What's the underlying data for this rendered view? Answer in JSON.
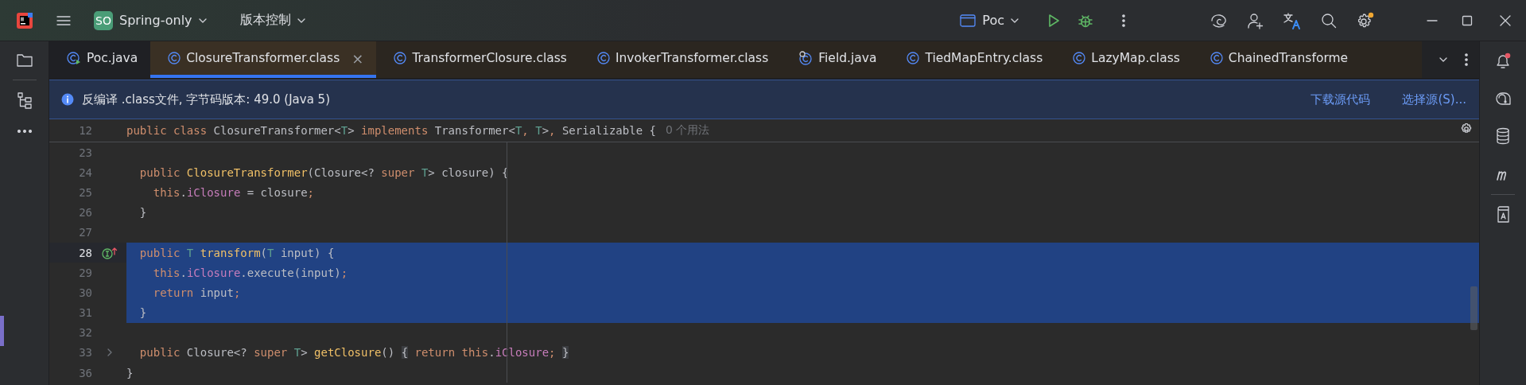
{
  "title_bar": {
    "project_badge": "SO",
    "project": "Spring-only",
    "vcs": "版本控制",
    "run_config": "Poc"
  },
  "tabs": [
    {
      "label": "Poc.java",
      "kind": "runnable",
      "selected": false
    },
    {
      "label": "ClosureTransformer.class",
      "kind": "class",
      "selected": true,
      "close": "×"
    },
    {
      "label": "TransformerClosure.class",
      "kind": "class",
      "selected": false
    },
    {
      "label": "InvokerTransformer.class",
      "kind": "class",
      "selected": false
    },
    {
      "label": "Field.java",
      "kind": "locked",
      "selected": false
    },
    {
      "label": "TiedMapEntry.class",
      "kind": "class",
      "selected": false
    },
    {
      "label": "LazyMap.class",
      "kind": "class",
      "selected": false
    },
    {
      "label": "ChainedTransforme",
      "kind": "class",
      "selected": false
    }
  ],
  "banner": {
    "text": "反编译 .class文件, 字节码版本: 49.0 (Java 5)",
    "links": [
      "下载源代码",
      "选择源(S)..."
    ]
  },
  "editor": {
    "sticky": {
      "number": "12",
      "hint": "0 个用法",
      "tokens": [
        {
          "text": "public class ",
          "kind": "kw"
        },
        {
          "text": "ClosureTransformer<",
          "kind": "plain"
        },
        {
          "text": "T",
          "kind": "tparam"
        },
        {
          "text": "> ",
          "kind": "plain"
        },
        {
          "text": "implements ",
          "kind": "kw"
        },
        {
          "text": "Transformer<",
          "kind": "plain"
        },
        {
          "text": "T",
          "kind": "tparam"
        },
        {
          "text": ", ",
          "kind": "kw"
        },
        {
          "text": "T",
          "kind": "tparam"
        },
        {
          "text": ">",
          "kind": "plain"
        },
        {
          "text": ", ",
          "kind": "kw"
        },
        {
          "text": "Serializable {",
          "kind": "plain"
        }
      ]
    },
    "lines": [
      {
        "number": "23",
        "selected": false,
        "current": false
      },
      {
        "number": "24",
        "selected": false,
        "current": false,
        "tokens": [
          {
            "text": "  public ",
            "kind": "kw"
          },
          {
            "text": "ClosureTransformer",
            "kind": "decl"
          },
          {
            "text": "(Closure<? ",
            "kind": "plain"
          },
          {
            "text": "super ",
            "kind": "kw"
          },
          {
            "text": "T",
            "kind": "tparam"
          },
          {
            "text": "> closure) {",
            "kind": "plain"
          }
        ]
      },
      {
        "number": "25",
        "selected": false,
        "current": false,
        "tokens": [
          {
            "text": "    this",
            "kind": "kw"
          },
          {
            "text": ".",
            "kind": "plain"
          },
          {
            "text": "iClosure",
            "kind": "field"
          },
          {
            "text": " = closure",
            "kind": "plain"
          },
          {
            "text": ";",
            "kind": "kw"
          }
        ]
      },
      {
        "number": "26",
        "selected": false,
        "current": false,
        "tokens": [
          {
            "text": "  }",
            "kind": "plain"
          }
        ]
      },
      {
        "number": "27",
        "selected": false,
        "current": false
      },
      {
        "number": "28",
        "selected": true,
        "current": true,
        "implementation_marker": true,
        "tokens": [
          {
            "text": "  public ",
            "kind": "kw"
          },
          {
            "text": "T ",
            "kind": "tparam"
          },
          {
            "text": "transform",
            "kind": "decl"
          },
          {
            "text": "(",
            "kind": "plain"
          },
          {
            "text": "T ",
            "kind": "tparam"
          },
          {
            "text": "input) {",
            "kind": "plain"
          }
        ]
      },
      {
        "number": "29",
        "selected": true,
        "current": false,
        "tokens": [
          {
            "text": "    this",
            "kind": "kw"
          },
          {
            "text": ".",
            "kind": "plain"
          },
          {
            "text": "iClosure",
            "kind": "field"
          },
          {
            "text": ".execute(input)",
            "kind": "plain"
          },
          {
            "text": ";",
            "kind": "kw"
          }
        ]
      },
      {
        "number": "30",
        "selected": true,
        "current": false,
        "tokens": [
          {
            "text": "    return ",
            "kind": "kw"
          },
          {
            "text": "input",
            "kind": "plain"
          },
          {
            "text": ";",
            "kind": "kw"
          }
        ]
      },
      {
        "number": "31",
        "selected": true,
        "current": false,
        "tokens": [
          {
            "text": "  }",
            "kind": "plain"
          }
        ]
      },
      {
        "number": "32",
        "selected": false,
        "current": false
      },
      {
        "number": "33",
        "selected": false,
        "current": false,
        "collapsed": true,
        "tokens": [
          {
            "text": "  public ",
            "kind": "kw"
          },
          {
            "text": "Closure<? ",
            "kind": "plain"
          },
          {
            "text": "super ",
            "kind": "kw"
          },
          {
            "text": "T",
            "kind": "tparam"
          },
          {
            "text": "> ",
            "kind": "plain"
          },
          {
            "text": "getClosure",
            "kind": "decl"
          },
          {
            "text": "() ",
            "kind": "plain"
          },
          {
            "text": "{",
            "kind": "fold"
          },
          {
            "text": " return this",
            "kind": "kw"
          },
          {
            "text": ".",
            "kind": "plain"
          },
          {
            "text": "iClosure",
            "kind": "field"
          },
          {
            "text": "; ",
            "kind": "kw"
          },
          {
            "text": "}",
            "kind": "fold"
          }
        ]
      },
      {
        "number": "36",
        "selected": false,
        "current": false,
        "tokens": [
          {
            "text": "}",
            "kind": "plain"
          }
        ]
      }
    ]
  }
}
